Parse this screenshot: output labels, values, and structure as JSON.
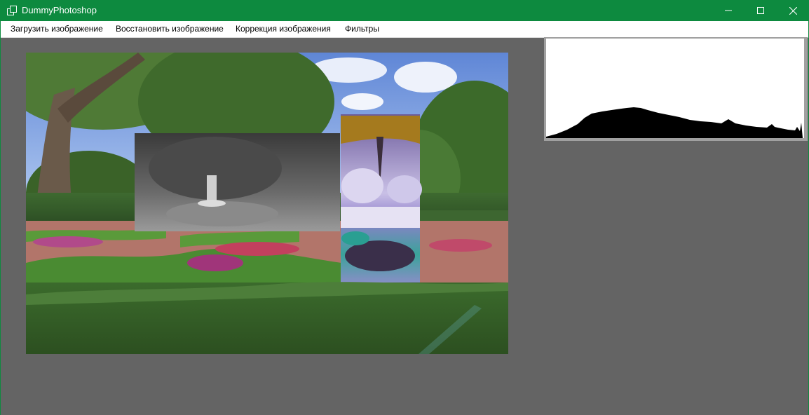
{
  "window": {
    "title": "DummyPhotoshop",
    "controls": {
      "minimize_icon": "minimize-icon",
      "maximize_icon": "maximize-icon",
      "close_icon": "close-icon"
    }
  },
  "menu": {
    "items": [
      {
        "label": "Загрузить изображение"
      },
      {
        "label": "Восстановить изображение"
      },
      {
        "label": "Коррекция изображения"
      },
      {
        "label": "Фильтры"
      }
    ]
  },
  "colors": {
    "titlebar": "#0d8a3f",
    "workspace": "#646464",
    "histogram_bg": "#ffffff",
    "histogram_fill": "#000000"
  }
}
